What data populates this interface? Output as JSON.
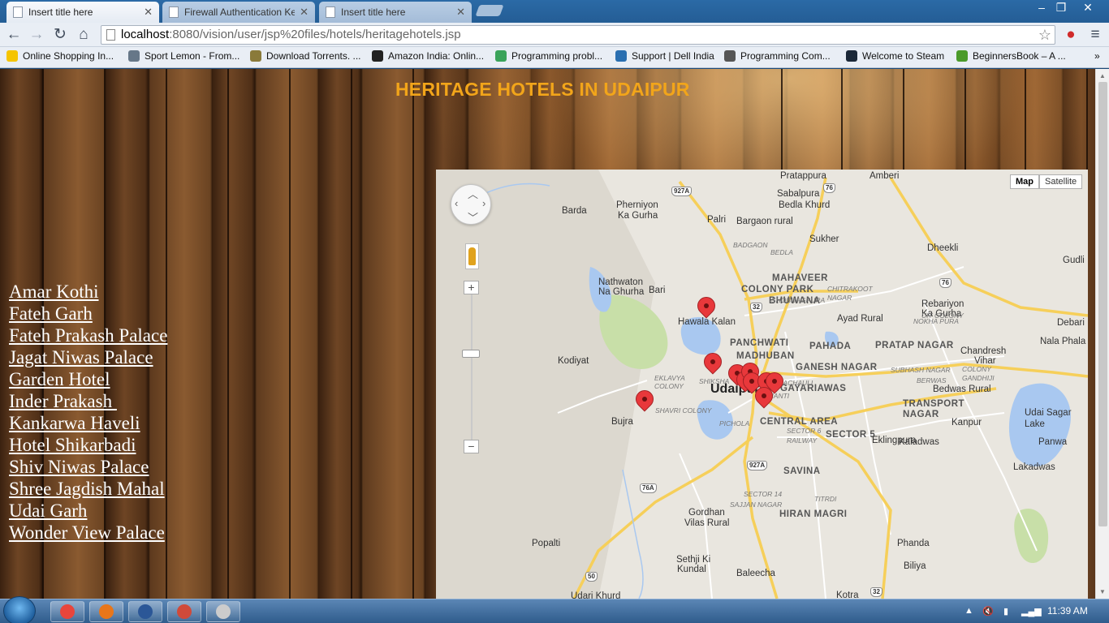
{
  "browser": {
    "tabs": [
      {
        "label": "Insert title here",
        "active": true
      },
      {
        "label": "Firewall Authentication Ke",
        "active": false
      },
      {
        "label": "Insert title here",
        "active": false
      }
    ],
    "url_host": "localhost",
    "url_path": ":8080/vision/user/jsp%20files/hotels/heritagehotels.jsp",
    "bookmarks": [
      {
        "label": "Online Shopping In...",
        "icon": "flipkart-icon",
        "color": "#f5c400"
      },
      {
        "label": "Sport Lemon - From...",
        "icon": "runner-icon",
        "color": "#667788"
      },
      {
        "label": "Download Torrents. ...",
        "icon": "shield-icon",
        "color": "#8a7a3a"
      },
      {
        "label": "Amazon India: Onlin...",
        "icon": "amazon-icon",
        "color": "#222222"
      },
      {
        "label": "Programming probl...",
        "icon": "hackerearth-icon",
        "color": "#3aa35a"
      },
      {
        "label": "Support | Dell India",
        "icon": "dell-icon",
        "color": "#2a6fb0"
      },
      {
        "label": "Programming Com...",
        "icon": "cc-icon",
        "color": "#555555"
      },
      {
        "label": "Welcome to Steam",
        "icon": "steam-icon",
        "color": "#1b2838"
      },
      {
        "label": "BeginnersBook – A ...",
        "icon": "beginnersbook-icon",
        "color": "#4a9a2a"
      }
    ],
    "overflow": "»"
  },
  "page": {
    "title": "HERITAGE HOTELS IN UDAIPUR",
    "hotels": [
      "Amar Kothi",
      "Fateh Garh",
      "Fateh Prakash Palace",
      "Jagat Niwas Palace",
      "Garden Hotel",
      "Inder Prakash ",
      "Kankarwa Haveli",
      "Hotel Shikarbadi",
      "Shiv Niwas Palace",
      "Shree Jagdish Mahal",
      "Udai Garh",
      "Wonder View Palace"
    ]
  },
  "map": {
    "type_buttons": [
      "Map",
      "Satellite"
    ],
    "selected_type": "Map",
    "zoom_in": "+",
    "zoom_out": "−",
    "labels": [
      {
        "text": "Pratappura",
        "cls": ""
      },
      {
        "text": "Amberi",
        "cls": ""
      },
      {
        "text": "Sabalpura",
        "cls": ""
      },
      {
        "text": "Bedla Khurd",
        "cls": ""
      },
      {
        "text": "Barda",
        "cls": ""
      },
      {
        "text": "Pherniyon",
        "cls": ""
      },
      {
        "text": "Ka Gurha",
        "cls": ""
      },
      {
        "text": "Palri",
        "cls": ""
      },
      {
        "text": "Bargaon rural",
        "cls": ""
      },
      {
        "text": "Sukher",
        "cls": ""
      },
      {
        "text": "Dheekli",
        "cls": ""
      },
      {
        "text": "Gudli",
        "cls": ""
      },
      {
        "text": "Nathwaton",
        "cls": ""
      },
      {
        "text": "Na Ghurha",
        "cls": ""
      },
      {
        "text": "Bari",
        "cls": ""
      },
      {
        "text": "MAHAVEER",
        "cls": "area"
      },
      {
        "text": "COLONY PARK",
        "cls": "area"
      },
      {
        "text": "BHUWANA",
        "cls": "area"
      },
      {
        "text": "Rebariyon",
        "cls": ""
      },
      {
        "text": "Ka Gurha",
        "cls": ""
      },
      {
        "text": "Hawala Kalan",
        "cls": ""
      },
      {
        "text": "Ayad Rural",
        "cls": ""
      },
      {
        "text": "Debari",
        "cls": ""
      },
      {
        "text": "PANCHWATI",
        "cls": "area"
      },
      {
        "text": "PAHADA",
        "cls": "area"
      },
      {
        "text": "PRATAP NAGAR",
        "cls": "area"
      },
      {
        "text": "Chandresh",
        "cls": ""
      },
      {
        "text": "Vihar",
        "cls": ""
      },
      {
        "text": "Nala Phala",
        "cls": ""
      },
      {
        "text": "Kodiyat",
        "cls": ""
      },
      {
        "text": "MADHUBAN",
        "cls": "area"
      },
      {
        "text": "GANESH NAGAR",
        "cls": "area"
      },
      {
        "text": "Udaipur",
        "cls": "big"
      },
      {
        "text": "Bedwas Rural",
        "cls": ""
      },
      {
        "text": "GAYARIAWAS",
        "cls": "area"
      },
      {
        "text": "TRANSPORT",
        "cls": "area"
      },
      {
        "text": "NAGAR",
        "cls": "area"
      },
      {
        "text": "Udai Sagar",
        "cls": ""
      },
      {
        "text": "Lake",
        "cls": ""
      },
      {
        "text": "Bujra",
        "cls": ""
      },
      {
        "text": "CENTRAL AREA",
        "cls": "area"
      },
      {
        "text": "SECTOR 5",
        "cls": "area"
      },
      {
        "text": "Kanpur",
        "cls": ""
      },
      {
        "text": "Kaladwas",
        "cls": ""
      },
      {
        "text": "Panwa",
        "cls": ""
      },
      {
        "text": "Eklingpura",
        "cls": ""
      },
      {
        "text": "Lakadwas",
        "cls": ""
      },
      {
        "text": "SAVINA",
        "cls": "area"
      },
      {
        "text": "HIRAN MAGRI",
        "cls": "area"
      },
      {
        "text": "Gordhan",
        "cls": ""
      },
      {
        "text": "Vilas Rural",
        "cls": ""
      },
      {
        "text": "Phanda",
        "cls": ""
      },
      {
        "text": "Popalti",
        "cls": ""
      },
      {
        "text": "Sethji Ki",
        "cls": ""
      },
      {
        "text": "Kundal",
        "cls": ""
      },
      {
        "text": "Baleecha",
        "cls": ""
      },
      {
        "text": "Biliya",
        "cls": ""
      },
      {
        "text": "Udari Khurd",
        "cls": ""
      },
      {
        "text": "Kotra",
        "cls": ""
      },
      {
        "text": "EKLAVYA",
        "cls": "sm"
      },
      {
        "text": "COLONY",
        "cls": "sm"
      },
      {
        "text": "SHAVRI COLONY",
        "cls": "sm"
      },
      {
        "text": "PICHOLA",
        "cls": "sm"
      },
      {
        "text": "SAJJAN NAGAR",
        "cls": "sm"
      },
      {
        "text": "SECTOR 14",
        "cls": "sm"
      },
      {
        "text": "TITRDI",
        "cls": "sm"
      },
      {
        "text": "BADGAON",
        "cls": "sm"
      },
      {
        "text": "BEDLA",
        "cls": "sm"
      },
      {
        "text": "CHITRAKOOT",
        "cls": "sm"
      },
      {
        "text": "NAGAR",
        "cls": "sm"
      },
      {
        "text": "SHOBHAGPURA",
        "cls": "sm"
      },
      {
        "text": "NOKHA PURA",
        "cls": "sm"
      },
      {
        "text": "UIT COLONY",
        "cls": "sm"
      },
      {
        "text": "BERWAS",
        "cls": "sm"
      },
      {
        "text": "SUBHASH NAGAR",
        "cls": "sm"
      },
      {
        "text": "SHANTI",
        "cls": "sm"
      },
      {
        "text": "SECTOR 6",
        "cls": "sm"
      },
      {
        "text": "RAILWAY",
        "cls": "sm"
      },
      {
        "text": "COLONY",
        "cls": "sm"
      },
      {
        "text": "GANDHIJI",
        "cls": "sm"
      },
      {
        "text": "KI PACHAULI",
        "cls": "sm"
      },
      {
        "text": "SHIKSHA",
        "cls": "sm"
      },
      {
        "text": "AMBAMATA",
        "cls": "sm"
      }
    ],
    "highways": [
      "927A",
      "76",
      "32",
      "76",
      "927A",
      "76A",
      "50",
      "32"
    ],
    "pin_count": 10
  },
  "taskbar": {
    "clock": "11:39 AM",
    "apps": [
      {
        "name": "chrome",
        "color": "#e8453c"
      },
      {
        "name": "firefox",
        "color": "#e8761a"
      },
      {
        "name": "word",
        "color": "#2b5797"
      },
      {
        "name": "app-red",
        "color": "#d04a3a"
      },
      {
        "name": "settings",
        "color": "#cccccc"
      }
    ]
  },
  "colors": {
    "title": "#f2a51a",
    "link": "#ffffff",
    "water": "#a9c8f0",
    "park": "#c8dfa8",
    "road_major": "#f6cf5a",
    "road_minor": "#ffffff",
    "pin": "#e8383b"
  }
}
